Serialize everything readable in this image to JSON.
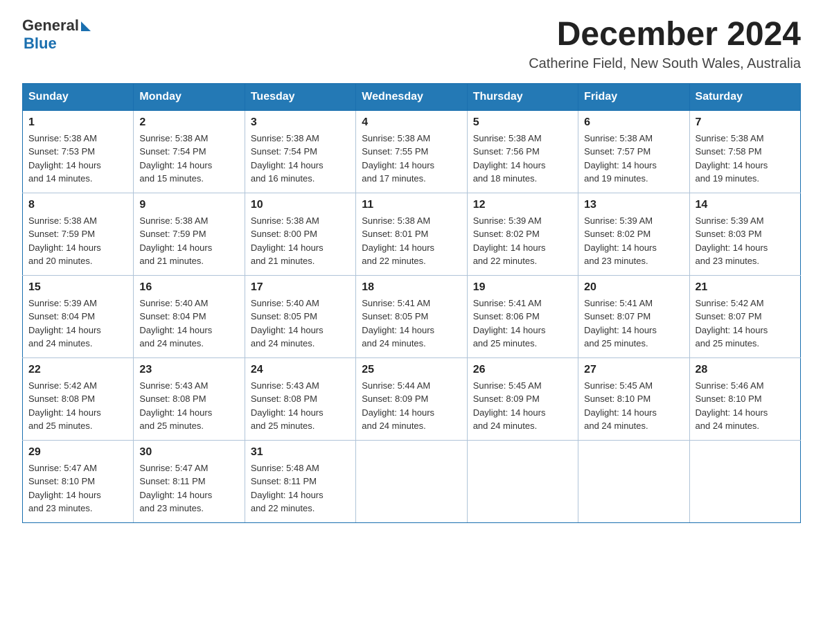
{
  "header": {
    "logo_general": "General",
    "logo_blue": "Blue",
    "month_year": "December 2024",
    "location": "Catherine Field, New South Wales, Australia"
  },
  "days_of_week": [
    "Sunday",
    "Monday",
    "Tuesday",
    "Wednesday",
    "Thursday",
    "Friday",
    "Saturday"
  ],
  "weeks": [
    [
      {
        "day": 1,
        "sunrise": "5:38 AM",
        "sunset": "7:53 PM",
        "daylight": "14 hours and 14 minutes."
      },
      {
        "day": 2,
        "sunrise": "5:38 AM",
        "sunset": "7:54 PM",
        "daylight": "14 hours and 15 minutes."
      },
      {
        "day": 3,
        "sunrise": "5:38 AM",
        "sunset": "7:54 PM",
        "daylight": "14 hours and 16 minutes."
      },
      {
        "day": 4,
        "sunrise": "5:38 AM",
        "sunset": "7:55 PM",
        "daylight": "14 hours and 17 minutes."
      },
      {
        "day": 5,
        "sunrise": "5:38 AM",
        "sunset": "7:56 PM",
        "daylight": "14 hours and 18 minutes."
      },
      {
        "day": 6,
        "sunrise": "5:38 AM",
        "sunset": "7:57 PM",
        "daylight": "14 hours and 19 minutes."
      },
      {
        "day": 7,
        "sunrise": "5:38 AM",
        "sunset": "7:58 PM",
        "daylight": "14 hours and 19 minutes."
      }
    ],
    [
      {
        "day": 8,
        "sunrise": "5:38 AM",
        "sunset": "7:59 PM",
        "daylight": "14 hours and 20 minutes."
      },
      {
        "day": 9,
        "sunrise": "5:38 AM",
        "sunset": "7:59 PM",
        "daylight": "14 hours and 21 minutes."
      },
      {
        "day": 10,
        "sunrise": "5:38 AM",
        "sunset": "8:00 PM",
        "daylight": "14 hours and 21 minutes."
      },
      {
        "day": 11,
        "sunrise": "5:38 AM",
        "sunset": "8:01 PM",
        "daylight": "14 hours and 22 minutes."
      },
      {
        "day": 12,
        "sunrise": "5:39 AM",
        "sunset": "8:02 PM",
        "daylight": "14 hours and 22 minutes."
      },
      {
        "day": 13,
        "sunrise": "5:39 AM",
        "sunset": "8:02 PM",
        "daylight": "14 hours and 23 minutes."
      },
      {
        "day": 14,
        "sunrise": "5:39 AM",
        "sunset": "8:03 PM",
        "daylight": "14 hours and 23 minutes."
      }
    ],
    [
      {
        "day": 15,
        "sunrise": "5:39 AM",
        "sunset": "8:04 PM",
        "daylight": "14 hours and 24 minutes."
      },
      {
        "day": 16,
        "sunrise": "5:40 AM",
        "sunset": "8:04 PM",
        "daylight": "14 hours and 24 minutes."
      },
      {
        "day": 17,
        "sunrise": "5:40 AM",
        "sunset": "8:05 PM",
        "daylight": "14 hours and 24 minutes."
      },
      {
        "day": 18,
        "sunrise": "5:41 AM",
        "sunset": "8:05 PM",
        "daylight": "14 hours and 24 minutes."
      },
      {
        "day": 19,
        "sunrise": "5:41 AM",
        "sunset": "8:06 PM",
        "daylight": "14 hours and 25 minutes."
      },
      {
        "day": 20,
        "sunrise": "5:41 AM",
        "sunset": "8:07 PM",
        "daylight": "14 hours and 25 minutes."
      },
      {
        "day": 21,
        "sunrise": "5:42 AM",
        "sunset": "8:07 PM",
        "daylight": "14 hours and 25 minutes."
      }
    ],
    [
      {
        "day": 22,
        "sunrise": "5:42 AM",
        "sunset": "8:08 PM",
        "daylight": "14 hours and 25 minutes."
      },
      {
        "day": 23,
        "sunrise": "5:43 AM",
        "sunset": "8:08 PM",
        "daylight": "14 hours and 25 minutes."
      },
      {
        "day": 24,
        "sunrise": "5:43 AM",
        "sunset": "8:08 PM",
        "daylight": "14 hours and 25 minutes."
      },
      {
        "day": 25,
        "sunrise": "5:44 AM",
        "sunset": "8:09 PM",
        "daylight": "14 hours and 24 minutes."
      },
      {
        "day": 26,
        "sunrise": "5:45 AM",
        "sunset": "8:09 PM",
        "daylight": "14 hours and 24 minutes."
      },
      {
        "day": 27,
        "sunrise": "5:45 AM",
        "sunset": "8:10 PM",
        "daylight": "14 hours and 24 minutes."
      },
      {
        "day": 28,
        "sunrise": "5:46 AM",
        "sunset": "8:10 PM",
        "daylight": "14 hours and 24 minutes."
      }
    ],
    [
      {
        "day": 29,
        "sunrise": "5:47 AM",
        "sunset": "8:10 PM",
        "daylight": "14 hours and 23 minutes."
      },
      {
        "day": 30,
        "sunrise": "5:47 AM",
        "sunset": "8:11 PM",
        "daylight": "14 hours and 23 minutes."
      },
      {
        "day": 31,
        "sunrise": "5:48 AM",
        "sunset": "8:11 PM",
        "daylight": "14 hours and 22 minutes."
      },
      null,
      null,
      null,
      null
    ]
  ],
  "labels": {
    "sunrise": "Sunrise:",
    "sunset": "Sunset:",
    "daylight": "Daylight:"
  }
}
